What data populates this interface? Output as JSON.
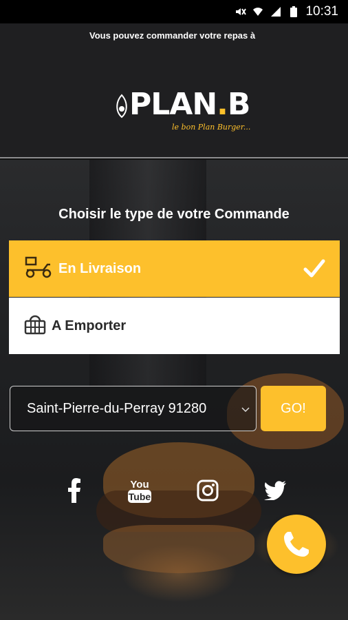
{
  "status_bar": {
    "time": "10:31"
  },
  "header": {
    "ticker": "Vous pouvez commander votre repas à",
    "logo_main": "PLAN",
    "logo_dot_letter": "B",
    "logo_tagline": "le bon Plan Burger..."
  },
  "order": {
    "title": "Choisir le type de votre Commande",
    "options": [
      {
        "label": "En Livraison",
        "selected": true,
        "icon": "delivery-scooter-icon"
      },
      {
        "label": "A Emporter",
        "selected": false,
        "icon": "basket-icon"
      }
    ]
  },
  "location": {
    "selected_city": "Saint-Pierre-du-Perray 91280",
    "go_label": "GO!"
  },
  "social": {
    "youtube_label_top": "You",
    "youtube_label_bottom": "Tube",
    "icons": [
      "facebook-icon",
      "youtube-icon",
      "instagram-icon",
      "twitter-icon"
    ]
  },
  "colors": {
    "accent": "#fdc02c",
    "header_bg": "#1f1f21"
  }
}
